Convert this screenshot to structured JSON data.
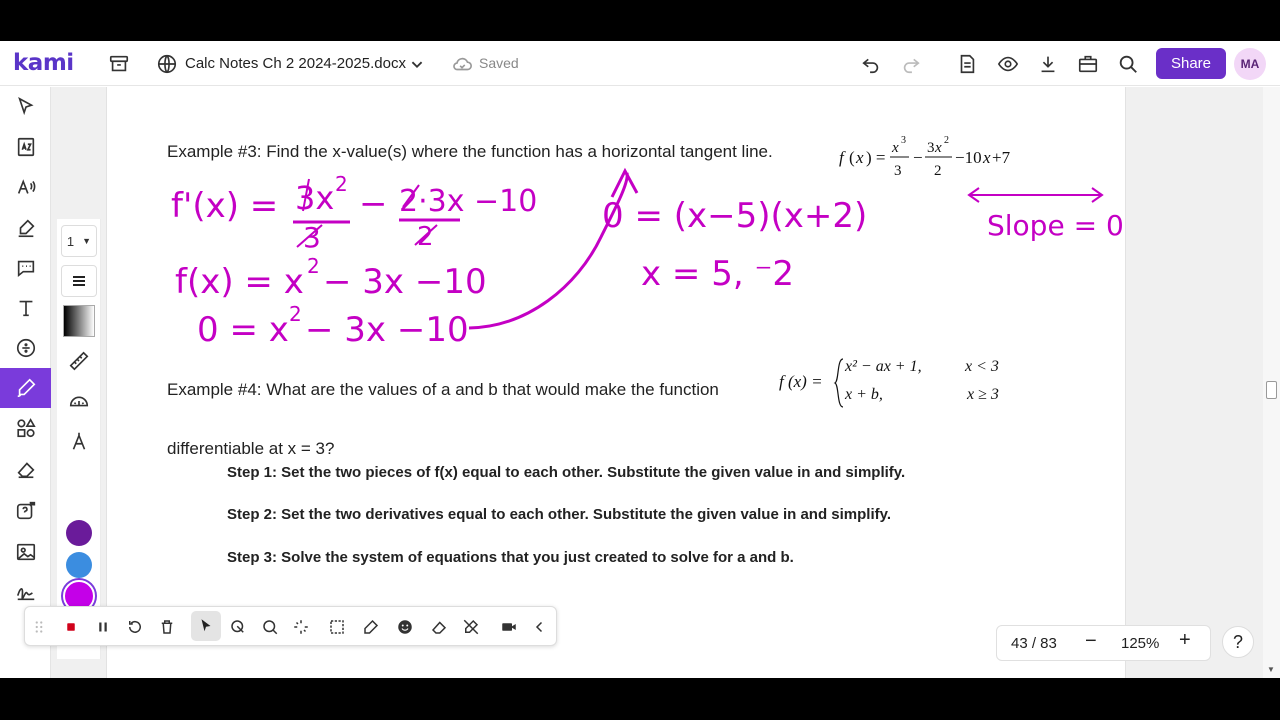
{
  "header": {
    "logo": "kami",
    "doc_title": "Calc Notes Ch 2 2024-2025.docx",
    "saved_label": "Saved",
    "share_label": "Share",
    "avatar_initials": "MA"
  },
  "document": {
    "example3_text": "Example #3: Find the x-value(s) where the function has a horizontal tangent line.",
    "example4_text": "Example #4: What are the values of a and b that would make the function",
    "example4_cont": "differentiable at x = 3?",
    "step1": "Step 1: Set the two pieces of f(x) equal to each other. Substitute the given value in and simplify.",
    "step2": "Step 2: Set the two derivatives equal to each other. Substitute the given value in and simplify.",
    "step3": "Step 3: Solve the system of equations that you just created to solve for a and b.",
    "fx_label": "f (x) =",
    "piece1": "x² − ax + 1,",
    "piece1_cond": "x < 3",
    "piece2": "x + b,",
    "piece2_cond": "x ≥ 3",
    "ink": {
      "line1": "f'(x) = 3x² − 2·3x − 10",
      "line2": "f(x) = x² − 3x − 10",
      "line3": "0 = x² − 3x − 10",
      "line4": "0 = (x−5)(x+2)",
      "line5": "x = 5, −2",
      "slope": "Slope = 0"
    }
  },
  "palette": {
    "page_select": "1"
  },
  "pagenav": {
    "page": "43 / 83",
    "zoom": "125%"
  },
  "colors": {
    "accent": "#6a2fc8",
    "ink": "#c400c4",
    "purple_dot": "#6a1b9a",
    "blue_dot": "#3b8de0",
    "magenta_dot": "#c400e8"
  }
}
